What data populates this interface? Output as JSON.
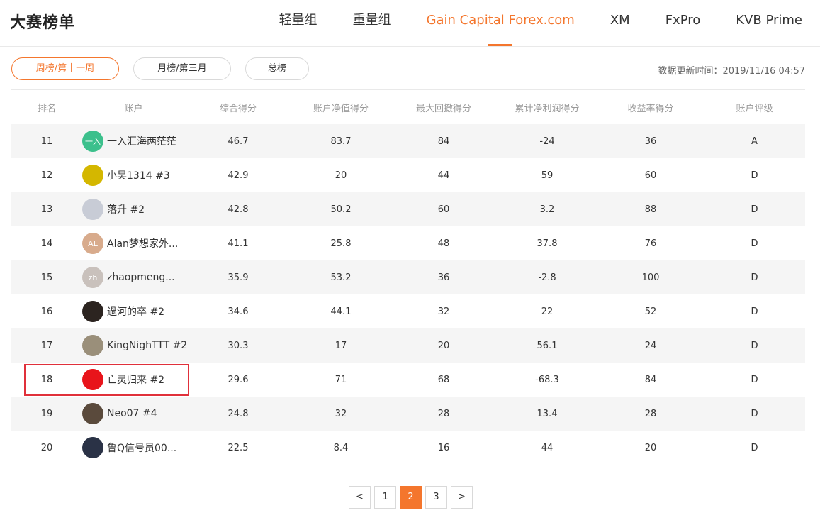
{
  "header": {
    "title": "大赛榜单",
    "nav": [
      "轻量组",
      "重量组",
      "Gain Capital Forex.com",
      "XM",
      "FxPro",
      "KVB Prime"
    ],
    "active_nav_index": 2
  },
  "filters": {
    "weekly": "周榜/第十一周",
    "monthly": "月榜/第三月",
    "overall": "总榜",
    "active": "weekly"
  },
  "update_time": "数据更新时间：2019/11/16 04:57",
  "columns": [
    "排名",
    "账户",
    "综合得分",
    "账户净值得分",
    "最大回撤得分",
    "累计净利润得分",
    "收益率得分",
    "账户评级"
  ],
  "rows": [
    {
      "rank": "11",
      "avatar_text": "一入",
      "avatar_color": "#3cc08c",
      "name": "一入汇海两茫茫",
      "total": "46.7",
      "equity": "83.7",
      "drawdown": "84",
      "profit": "-24",
      "return": "36",
      "grade": "A"
    },
    {
      "rank": "12",
      "avatar_text": "",
      "avatar_color": "#d4b700",
      "name": "小昊1314 #3",
      "total": "42.9",
      "equity": "20",
      "drawdown": "44",
      "profit": "59",
      "return": "60",
      "grade": "D"
    },
    {
      "rank": "13",
      "avatar_text": "",
      "avatar_color": "#c8ccd6",
      "name": "落升 #2",
      "total": "42.8",
      "equity": "50.2",
      "drawdown": "60",
      "profit": "3.2",
      "return": "88",
      "grade": "D"
    },
    {
      "rank": "14",
      "avatar_text": "AL",
      "avatar_color": "#d8ab8c",
      "name": "Alan梦想家外...",
      "total": "41.1",
      "equity": "25.8",
      "drawdown": "48",
      "profit": "37.8",
      "return": "76",
      "grade": "D"
    },
    {
      "rank": "15",
      "avatar_text": "zh",
      "avatar_color": "#c9c1bc",
      "name": "zhaopmeng...",
      "total": "35.9",
      "equity": "53.2",
      "drawdown": "36",
      "profit": "-2.8",
      "return": "100",
      "grade": "D"
    },
    {
      "rank": "16",
      "avatar_text": "",
      "avatar_color": "#2c2420",
      "name": "過河的卒 #2",
      "total": "34.6",
      "equity": "44.1",
      "drawdown": "32",
      "profit": "22",
      "return": "52",
      "grade": "D"
    },
    {
      "rank": "17",
      "avatar_text": "",
      "avatar_color": "#9a8f7a",
      "name": "KingNighTTT #2",
      "total": "30.3",
      "equity": "17",
      "drawdown": "20",
      "profit": "56.1",
      "return": "24",
      "grade": "D"
    },
    {
      "rank": "18",
      "avatar_text": "",
      "avatar_color": "#e8141b",
      "name": "亡灵归来 #2",
      "total": "29.6",
      "equity": "71",
      "drawdown": "68",
      "profit": "-68.3",
      "return": "84",
      "grade": "D"
    },
    {
      "rank": "19",
      "avatar_text": "",
      "avatar_color": "#5a4a3c",
      "name": "Neo07 #4",
      "total": "24.8",
      "equity": "32",
      "drawdown": "28",
      "profit": "13.4",
      "return": "28",
      "grade": "D"
    },
    {
      "rank": "20",
      "avatar_text": "",
      "avatar_color": "#2a3246",
      "name": "鲁Q信号员00...",
      "total": "22.5",
      "equity": "8.4",
      "drawdown": "16",
      "profit": "44",
      "return": "20",
      "grade": "D"
    }
  ],
  "pagination": {
    "prev": "<",
    "pages": [
      "1",
      "2",
      "3"
    ],
    "current": "2",
    "next": ">"
  },
  "colors": {
    "accent": "#f4762d",
    "highlight_border": "#e0303a"
  }
}
